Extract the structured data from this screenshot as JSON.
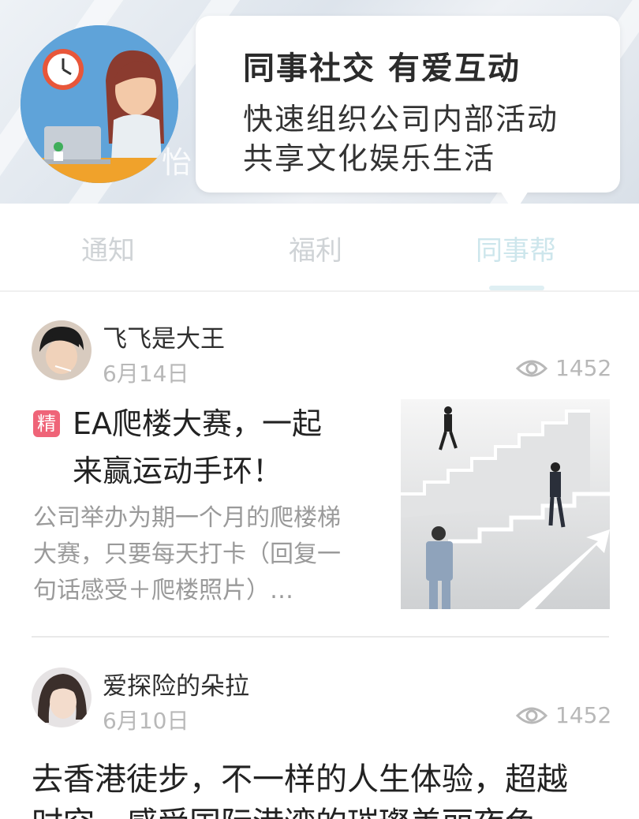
{
  "header": {
    "background_text": "怡",
    "tooltip": {
      "title": "同事社交 有爱互动",
      "line1": "快速组织公司内部活动",
      "line2": "共享文化娱乐生活"
    }
  },
  "tabs": [
    {
      "label": "通知",
      "active": false
    },
    {
      "label": "福利",
      "active": false
    },
    {
      "label": "同事帮",
      "active": true
    }
  ],
  "posts": [
    {
      "author": "飞飞是大王",
      "date": "6月14日",
      "views": "1452",
      "badge": "精",
      "title_line1": "EA爬楼大赛，一起",
      "title_line2": "来赢运动手环！",
      "excerpt_line1": "公司举办为期一个月的爬楼梯",
      "excerpt_line2": "大赛，只要每天打卡（回复一",
      "excerpt_line3": "句话感受＋爬楼照片）…"
    },
    {
      "author": "爱探险的朵拉",
      "date": "6月10日",
      "views": "1452",
      "title_line1": "去香港徒步，不一样的人生体验，超越",
      "title_line2": "时空，感受国际港湾的璀璨美丽夜色"
    }
  ],
  "colors": {
    "accent_tab": "#cde6ec",
    "badge": "#ef6478",
    "muted": "#b8b8b8"
  }
}
